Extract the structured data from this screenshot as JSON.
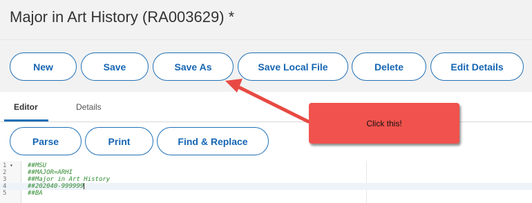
{
  "page": {
    "title": "Major in Art History (RA003629) *"
  },
  "toolbar": {
    "new": "New",
    "save": "Save",
    "save_as": "Save As",
    "save_local_file": "Save Local File",
    "delete": "Delete",
    "edit_details": "Edit Details"
  },
  "tabs": {
    "editor": "Editor",
    "details": "Details"
  },
  "editor_toolbar": {
    "parse": "Parse",
    "print": "Print",
    "find_replace": "Find & Replace"
  },
  "code_lines": [
    {
      "num": "1",
      "text": "##MSU"
    },
    {
      "num": "2",
      "text": "##MAJOR=ARHI"
    },
    {
      "num": "3",
      "text": "##Major in Art History"
    },
    {
      "num": "4",
      "text": "##202040-999999"
    },
    {
      "num": "5",
      "text": "##BA"
    }
  ],
  "annotation": {
    "callout_text": "Click this!"
  },
  "colors": {
    "accent": "#1f6fb5",
    "callout": "#f1524d",
    "arrow": "#e84a43"
  }
}
